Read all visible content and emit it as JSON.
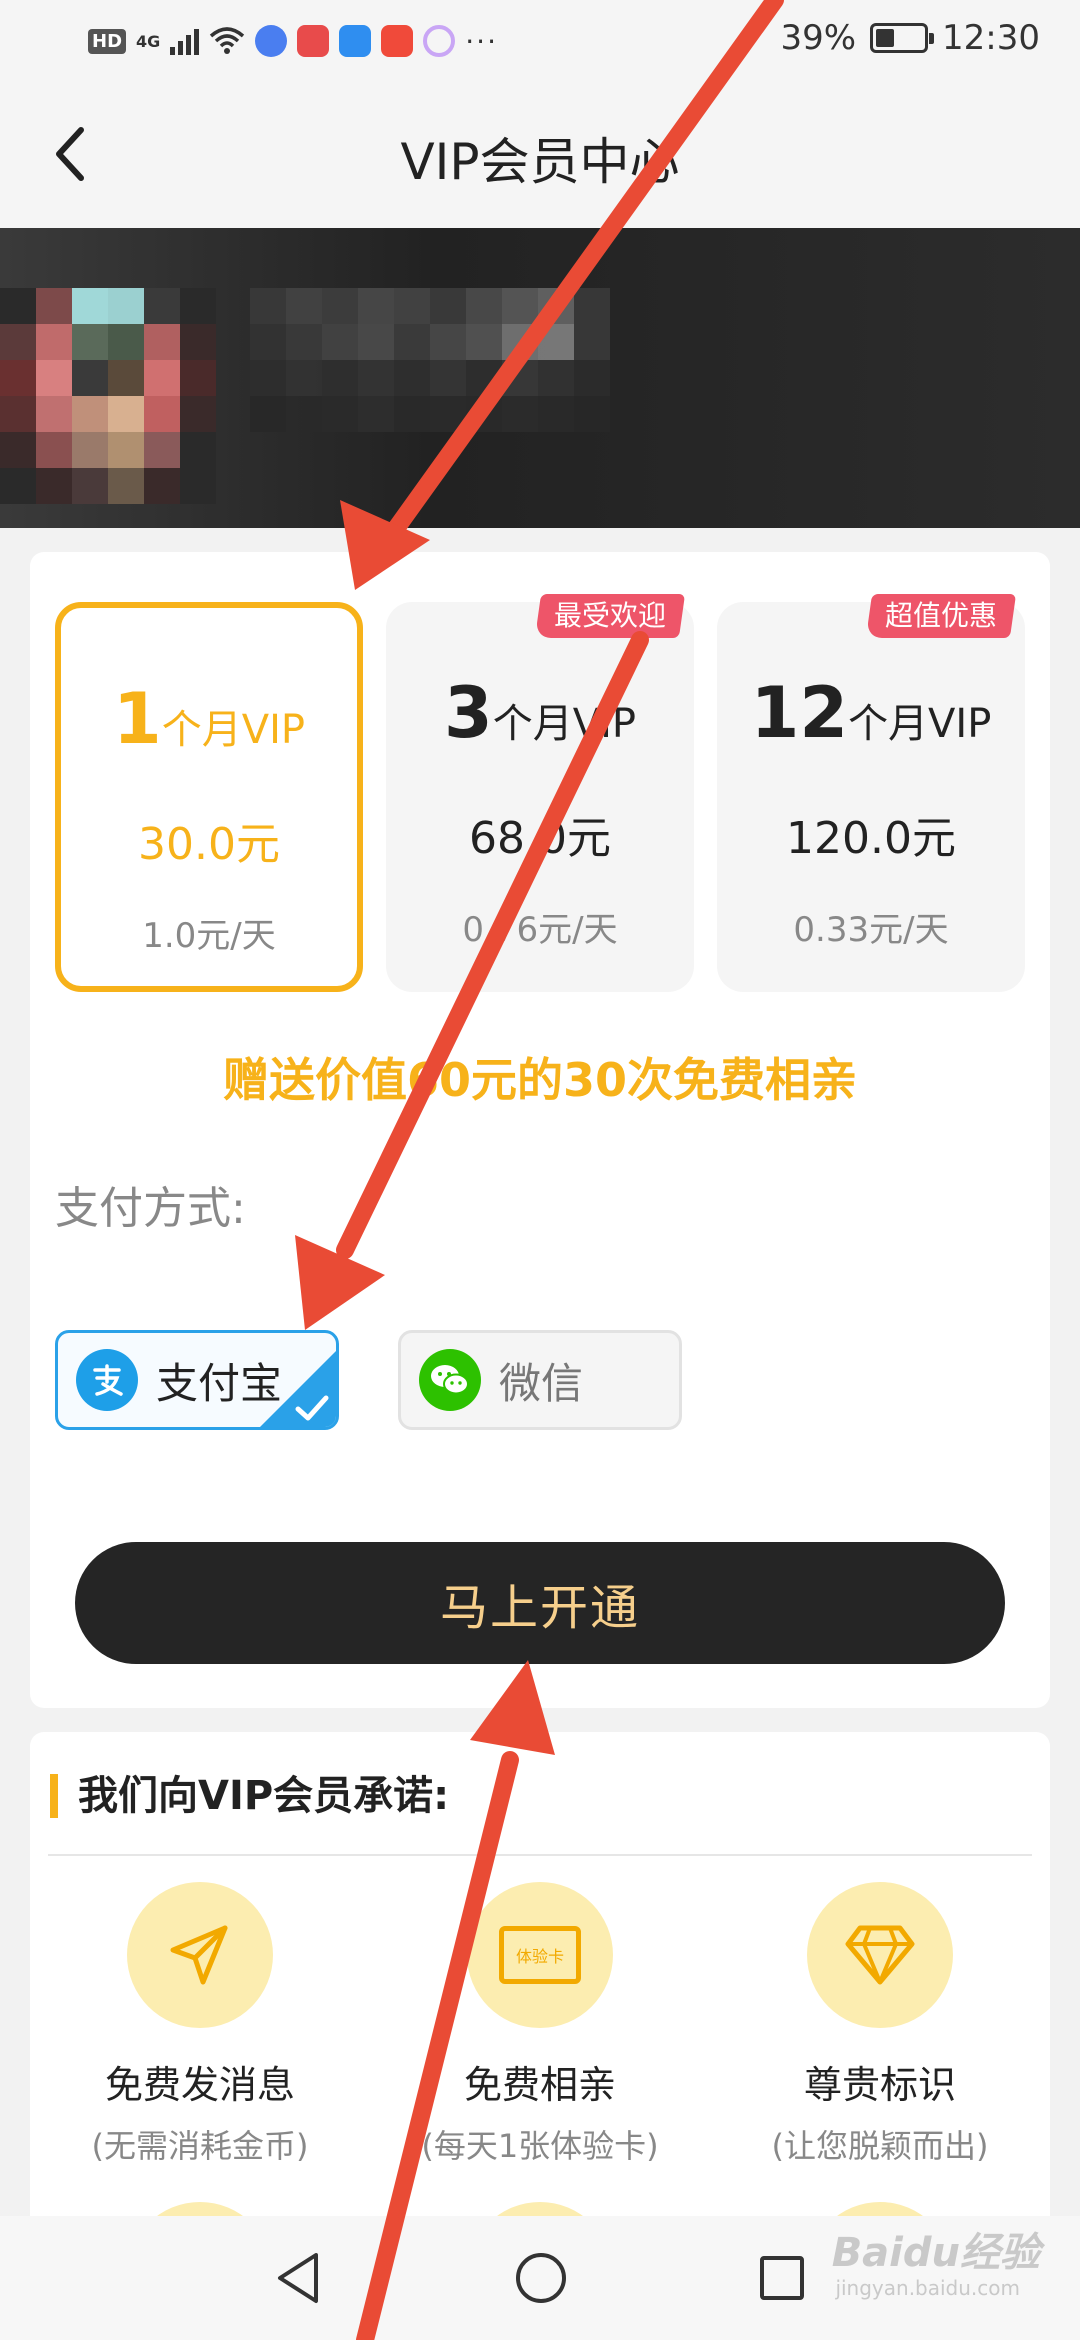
{
  "status_bar": {
    "left_label": "HD",
    "network": "4G",
    "battery": "39%",
    "battery_level": 0.39,
    "time": "12:30"
  },
  "header": {
    "title": "VIP会员中心",
    "back_icon": "chevron-left-icon"
  },
  "plans": [
    {
      "months": "1",
      "unit": "个月VIP",
      "price": "30.0元",
      "daily": "1.0元/天",
      "tag": "",
      "selected": true
    },
    {
      "months": "3",
      "unit": "个月VIP",
      "price": "68.0元",
      "daily": "0.76元/天",
      "tag": "最受欢迎",
      "selected": false
    },
    {
      "months": "12",
      "unit": "个月VIP",
      "price": "120.0元",
      "daily": "0.33元/天",
      "tag": "超值优惠",
      "selected": false
    }
  ],
  "gift_text": "赠送价值60元的30次免费相亲",
  "payment": {
    "label": "支付方式:",
    "options": [
      {
        "label": "支付宝",
        "icon": "alipay-icon",
        "selected": true,
        "color": "#1E9FE8"
      },
      {
        "label": "微信",
        "icon": "wechat-icon",
        "selected": false,
        "color": "#2DC100"
      }
    ]
  },
  "open_button": "马上开通",
  "promise": {
    "title": "我们向VIP会员承诺:",
    "benefits": [
      {
        "title": "免费发消息",
        "subtitle": "(无需消耗金币)",
        "icon": "paper-plane-icon"
      },
      {
        "title": "免费相亲",
        "subtitle": "(每天1张体验卡)",
        "icon": "trial-card-icon",
        "icon_text": "体验卡"
      },
      {
        "title": "尊贵标识",
        "subtitle": "(让您脱颖而出)",
        "icon": "diamond-icon"
      }
    ]
  },
  "watermark": {
    "brand": "Baidu经验",
    "url": "jingyan.baidu.com"
  },
  "colors": {
    "accent": "#F7B21A",
    "tag": "#EE5569",
    "button": "#252525",
    "button_text": "#F6CF8C",
    "alipay": "#2AA1E8",
    "arrow": "#E94B35"
  }
}
